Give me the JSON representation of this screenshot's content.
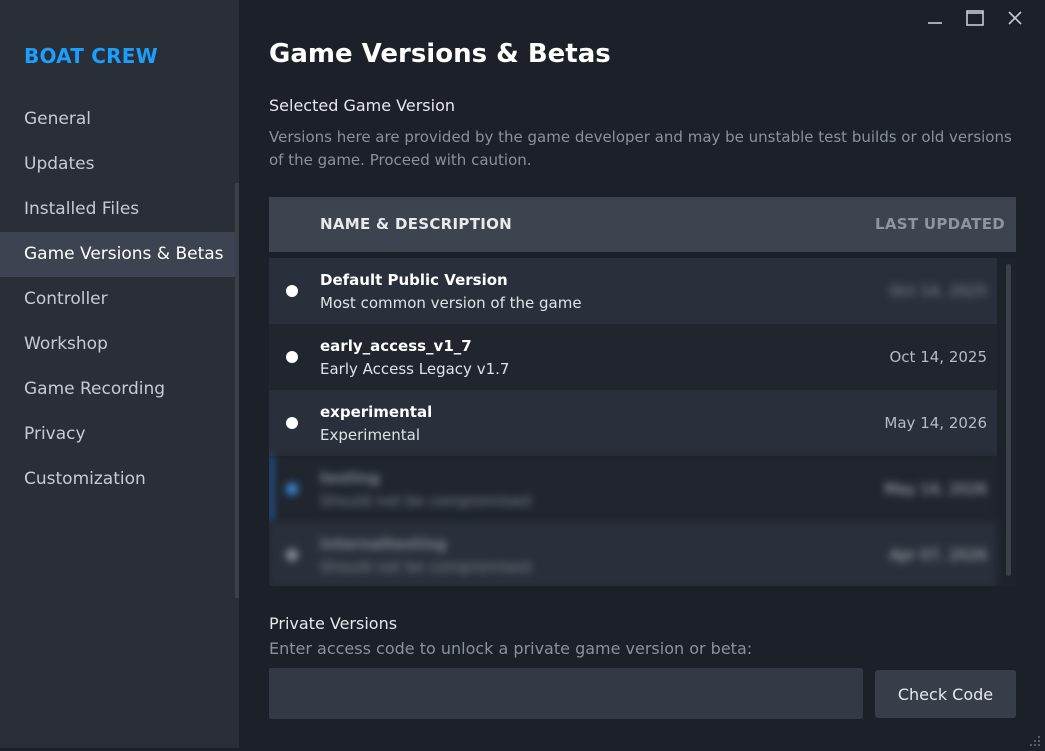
{
  "app": {
    "title": "BOAT CREW"
  },
  "sidebar": {
    "items": [
      {
        "label": "General"
      },
      {
        "label": "Updates"
      },
      {
        "label": "Installed Files"
      },
      {
        "label": "Game Versions & Betas",
        "active": true
      },
      {
        "label": "Controller"
      },
      {
        "label": "Workshop"
      },
      {
        "label": "Game Recording"
      },
      {
        "label": "Privacy"
      },
      {
        "label": "Customization"
      }
    ]
  },
  "window_controls": {
    "icons": [
      "minimize-icon",
      "maximize-icon",
      "close-icon"
    ]
  },
  "main": {
    "title": "Game Versions & Betas",
    "section_title": "Selected Game Version",
    "section_desc": "Versions here are provided by the game developer and may be unstable test builds or old versions of the game. Proceed with caution."
  },
  "table": {
    "col_name": "NAME & DESCRIPTION",
    "col_updated": "LAST UPDATED",
    "rows": [
      {
        "name": "Default Public Version",
        "desc": "Most common version of the game",
        "date": "Oct 14, 2025",
        "date_blurred": true
      },
      {
        "name": "early_access_v1_7",
        "desc": "Early Access Legacy v1.7",
        "date": "Oct 14, 2025"
      },
      {
        "name": "experimental",
        "desc": "Experimental",
        "date": "May 14, 2026"
      },
      {
        "name": "testing",
        "desc": "Should not be compromised",
        "date": "May 14, 2026",
        "blurred": true,
        "selected": true
      },
      {
        "name": "internaltesting",
        "desc": "Should not be compromised",
        "date": "Apr 07, 2026",
        "blurred": true
      }
    ]
  },
  "private": {
    "title": "Private Versions",
    "desc": "Enter access code to unlock a private game version or beta:",
    "input_value": "",
    "input_placeholder": "",
    "button_label": "Check Code"
  },
  "colors": {
    "accent": "#1a9fff",
    "selected": "#2a6cc2",
    "background": "#1b2029",
    "sidebar": "#2a2e37"
  }
}
